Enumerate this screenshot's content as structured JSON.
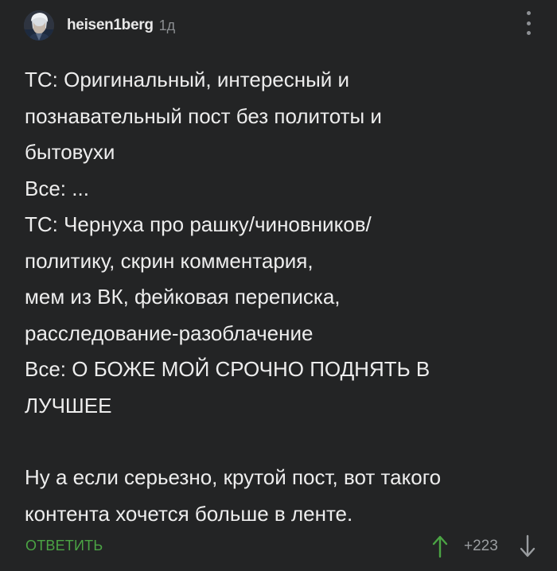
{
  "comment": {
    "author": "heisen1berg",
    "time": "1д",
    "body_lines": [
      "ТС: Оригинальный, интересный и",
      "познавательный пост без политоты и",
      "бытовухи",
      "Все: ...",
      "ТС: Чернуха про рашку/чиновников/",
      "политику, скрин комментария,",
      "мем из ВК, фейковая переписка,",
      "расследование-разоблачение",
      "Все: О БОЖЕ МОЙ СРОЧНО ПОДНЯТЬ В",
      "ЛУЧШЕЕ",
      "",
      "Ну а если серьезно, крутой пост, вот такого",
      "контента хочется больше в ленте."
    ],
    "reply_label": "ОТВЕТИТЬ",
    "rating": "+223"
  },
  "colors": {
    "background": "#232425",
    "text": "#ededed",
    "accent_green": "#4ba444",
    "muted": "#8b8e91"
  },
  "icons": {
    "avatar": "user-avatar-image",
    "more": "more-vertical-icon",
    "up": "arrow-up-icon",
    "down": "arrow-down-icon"
  }
}
